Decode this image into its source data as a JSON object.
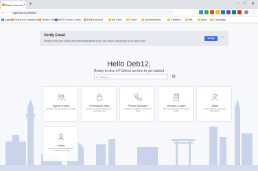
{
  "browser": {
    "tab_title": "Basic Console",
    "tab_close": "×",
    "new_tab": "+",
    "window_controls": [
      "–",
      "□",
      "✕"
    ],
    "url": "cginmon.m.ieifoliov",
    "nav": {
      "back": "←",
      "forward": "→",
      "reload": "↻"
    },
    "bookmarks": [
      "Apps",
      "Plosh Ani Dasbboa...",
      "Plosh Clien",
      "MRS Cloud Corea...",
      "Plostl Aimeal",
      "cid Lilan",
      "Cinue",
      "Alimvounstar",
      "Chietlos",
      "Mfi",
      "Bum",
      "Confuutgo"
    ]
  },
  "banner": {
    "title": "Verify Email",
    "text": "Please verify your email (deb.smmeasde@tesk.com). this action ong neaoly to ha dalie onoe.",
    "button": "Verify",
    "close": "×"
  },
  "greeting": "Hello Deb12,",
  "subtitle": "Ready to dive in? Select an item to get started",
  "search": {
    "placeholder": "Search..."
  },
  "cards": [
    {
      "title": "Agent Groups",
      "desc": "Manage your agent groups & skills"
    },
    {
      "title": "Permission Sets",
      "desc": "Group lots of permissions as a permission set"
    },
    {
      "title": "Phone Numbers",
      "desc": "Manage your phone numbers & flows"
    },
    {
      "title": "Reason Codes",
      "desc": "Allow your agents to set reason codes"
    },
    {
      "title": "Skills",
      "desc": "Create skills to route your interactions"
    },
    {
      "title": "Users",
      "desc": "Create users & manage user access to your org"
    }
  ],
  "colors": {
    "accent": "#3d6fd9",
    "icon": "#8a929c",
    "skyline": "#c3cde6"
  }
}
